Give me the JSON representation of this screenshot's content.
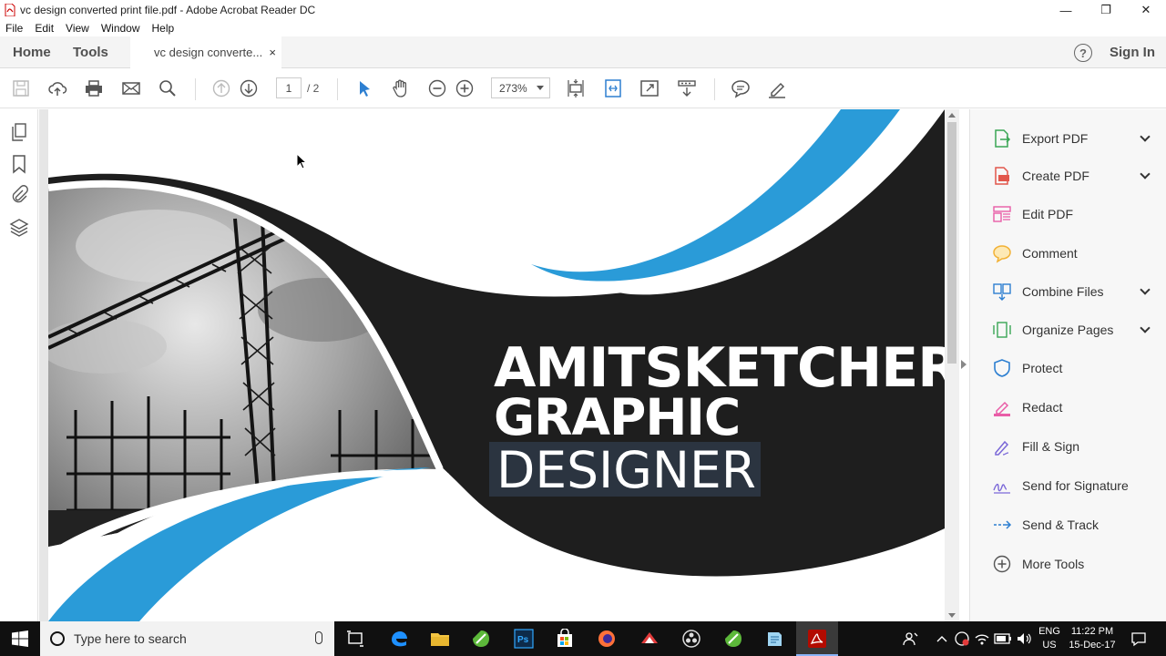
{
  "window": {
    "title": "vc design converted print file.pdf - Adobe Acrobat Reader DC",
    "controls": {
      "minimize": "—",
      "restore": "❐",
      "close": "✕"
    }
  },
  "menu": [
    "File",
    "Edit",
    "View",
    "Window",
    "Help"
  ],
  "tabs": {
    "home": "Home",
    "tools": "Tools",
    "document": "vc design converte...",
    "close": "×",
    "help": "?",
    "signin": "Sign In"
  },
  "toolbar": {
    "page_current": "1",
    "page_total": "/ 2",
    "zoom": "273%"
  },
  "document": {
    "line1": "AMITSKETCHER",
    "line2": "GRAPHIC",
    "line3": "DESIGNER",
    "colors": {
      "dark": "#1e1e1e",
      "blue": "#2a9bd8"
    }
  },
  "tools_pane": [
    {
      "label": "Export PDF",
      "icon": "export-pdf-icon",
      "chevron": true,
      "color": "#3aa655"
    },
    {
      "label": "Create PDF",
      "icon": "create-pdf-icon",
      "chevron": true,
      "color": "#e2574c"
    },
    {
      "label": "Edit PDF",
      "icon": "edit-pdf-icon",
      "chevron": false,
      "color": "#e95da7"
    },
    {
      "label": "Comment",
      "icon": "comment-icon",
      "chevron": false,
      "color": "#f2b134"
    },
    {
      "label": "Combine Files",
      "icon": "combine-files-icon",
      "chevron": true,
      "color": "#2d7fd1"
    },
    {
      "label": "Organize Pages",
      "icon": "organize-pages-icon",
      "chevron": true,
      "color": "#3aa655"
    },
    {
      "label": "Protect",
      "icon": "protect-icon",
      "chevron": false,
      "color": "#2d7fd1"
    },
    {
      "label": "Redact",
      "icon": "redact-icon",
      "chevron": false,
      "color": "#e95da7"
    },
    {
      "label": "Fill & Sign",
      "icon": "fill-sign-icon",
      "chevron": false,
      "color": "#7b68d8"
    },
    {
      "label": "Send for Signature",
      "icon": "send-for-signature-icon",
      "chevron": false,
      "color": "#7b68d8"
    },
    {
      "label": "Send & Track",
      "icon": "send-track-icon",
      "chevron": false,
      "color": "#2d7fd1"
    },
    {
      "label": "More Tools",
      "icon": "more-tools-icon",
      "chevron": false,
      "color": "#555555"
    }
  ],
  "taskbar": {
    "search_placeholder": "Type here to search",
    "lang_line1": "ENG",
    "lang_line2": "US",
    "time": "11:22 PM",
    "date": "15-Dec-17"
  }
}
